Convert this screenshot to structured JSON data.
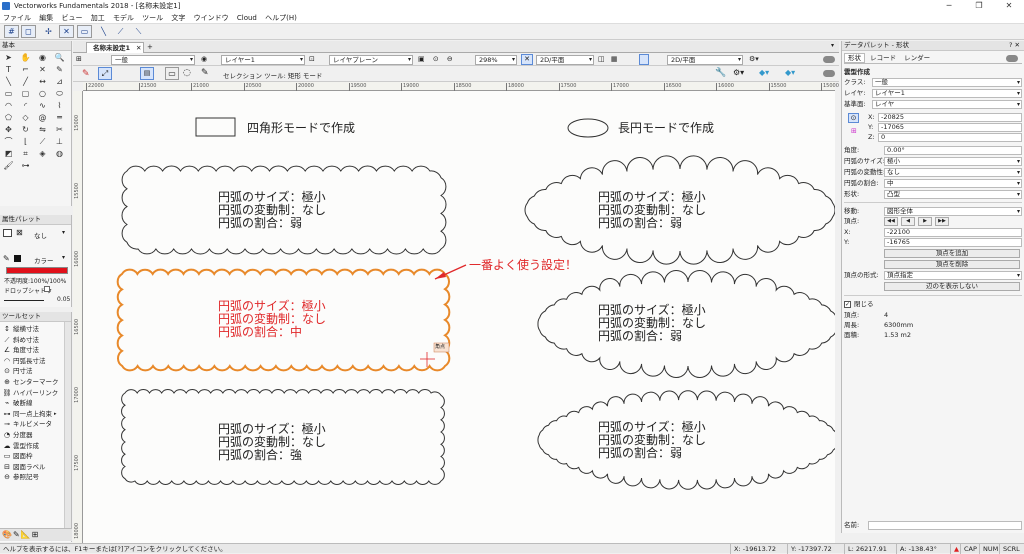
{
  "window": {
    "title": "Vectorworks Fundamentals 2018 - [名称未設定1]",
    "minimize": "─",
    "maximize": "❐",
    "close": "✕"
  },
  "menu": [
    "ファイル",
    "編集",
    "ビュー",
    "加工",
    "モデル",
    "ツール",
    "文字",
    "ウインドウ",
    "Cloud",
    "ヘルプ(H)"
  ],
  "palettes": {
    "basic": "基本",
    "attributes": "属性パレット",
    "attr_fill_none": "なし",
    "attr_color": "カラー",
    "attr_opacity": "不透明度:100%/100%",
    "attr_dropshadow": "ドロップシャドウ",
    "attr_lineweight": "0.05",
    "toolset": "ツールセット"
  },
  "toolset_items": [
    "縦横寸法",
    "斜め寸法",
    "角度寸法",
    "円弧長寸法",
    "円寸法",
    "センターマーク",
    "ハイパーリンク",
    "破断線",
    "同一点上拘束",
    "キルビメータ",
    "分度器",
    "雲型作成",
    "図面枠",
    "図面ラベル",
    "参照記号"
  ],
  "document_tab": "名称未設定1",
  "viewbar": {
    "class": "一般",
    "layer": "レイヤー1",
    "layer_plane": "レイヤプレーン",
    "zoom": "298%",
    "view": "2D/平面",
    "view2": "2D/平面"
  },
  "modebar": {
    "label": "セレクション ツール: 矩形 モード"
  },
  "ruler_h": [
    "22000",
    "21500",
    "21000",
    "20500",
    "20000",
    "19500",
    "19000",
    "18500",
    "18000",
    "17500",
    "17000",
    "16500",
    "16000",
    "15500",
    "15000"
  ],
  "ruler_v": [
    "15000",
    "15500",
    "16000",
    "16500",
    "17000",
    "17500",
    "18000"
  ],
  "canvas": {
    "rect_mode": "四角形モードで作成",
    "oval_mode": "長円モードで作成",
    "arrow_note": "一番よく使う設定！",
    "snap_tag": "角点",
    "clouds": [
      {
        "lines": [
          "円弧のサイズ：極小",
          "円弧の変動制：なし",
          "円弧の割合：弱"
        ]
      },
      {
        "lines": [
          "円弧のサイズ：極小",
          "円弧の変動制：なし",
          "円弧の割合：弱"
        ]
      },
      {
        "lines": [
          "円弧のサイズ：極小",
          "円弧の変動制：なし",
          "円弧の割合：中"
        ]
      },
      {
        "lines": [
          "円弧のサイズ：極小",
          "円弧の変動制：なし",
          "円弧の割合：弱"
        ]
      },
      {
        "lines": [
          "円弧のサイズ：極小",
          "円弧の変動制：なし",
          "円弧の割合：強"
        ]
      },
      {
        "lines": [
          "円弧のサイズ：極小",
          "円弧の変動制：なし",
          "円弧の割合：弱"
        ]
      }
    ]
  },
  "obj_info": {
    "title": "データパレット - 形状",
    "tabs": [
      "形状",
      "レコード",
      "レンダー"
    ],
    "object_type": "雲型作成",
    "class_label": "クラス:",
    "class_value": "一般",
    "layer_label": "レイヤ:",
    "layer_value": "レイヤー1",
    "plane_label": "基準面:",
    "plane_value": "レイヤ",
    "x_label": "X:",
    "x_value": "-20825",
    "y_label": "Y:",
    "y_value": "-17065",
    "z_label": "Z:",
    "z_value": "0",
    "angle_label": "角度:",
    "angle_value": "0.00°",
    "arc_size_label": "円弧のサイズ:",
    "arc_size_value": "極小",
    "arc_var_label": "円弧の変動性:",
    "arc_var_value": "なし",
    "arc_ratio_label": "円弧の割合:",
    "arc_ratio_value": "中",
    "shape_label": "形状:",
    "shape_value": "凸型",
    "move_label": "移動:",
    "move_value": "図形全体",
    "vertex_label": "頂点:",
    "vx_label": "X:",
    "vx_value": "-22100",
    "vy_label": "Y:",
    "vy_value": "-16765",
    "add_vertex": "頂点を追加",
    "delete_vertex": "頂点を削除",
    "vertex_type_label": "頂点の形式:",
    "vertex_type_value": "頂点指定",
    "hide_edges": "辺のを表示しない",
    "closed_label": "閉じる",
    "vcount_label": "頂点:",
    "vcount_value": "4",
    "perimeter_label": "周長:",
    "perimeter_value": "6300mm",
    "area_label": "面積:",
    "area_value": "1.53 m2",
    "name_label": "名前:"
  },
  "status": {
    "help": "ヘルプを表示するには、F1キーまたは[?]アイコンをクリックしてください。",
    "x": "X: -19613.72",
    "y": "Y: -17397.72",
    "l": "L: 26217.91",
    "a": "A: -138.43°",
    "cap": "CAP",
    "num": "NUM",
    "scrl": "SCRL"
  },
  "colors": {
    "accent": "#e8892a",
    "red_text": "#e0282a",
    "fill_swatch": "#e0101a",
    "cloud_stroke": "#333333"
  }
}
